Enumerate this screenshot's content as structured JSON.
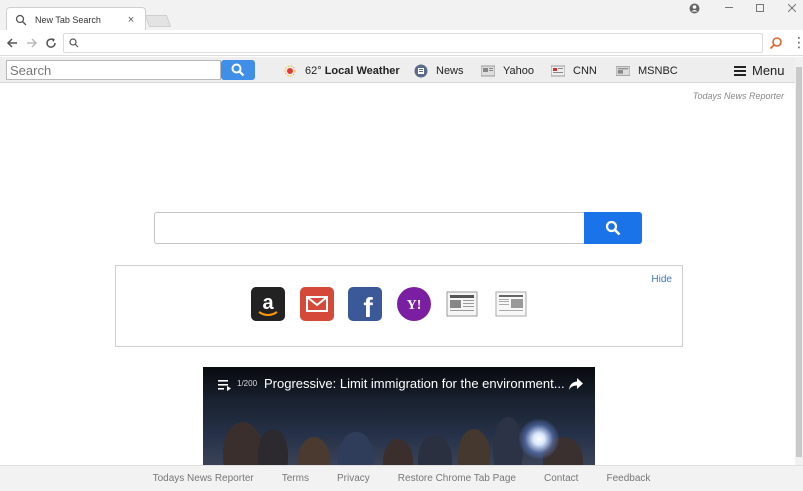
{
  "browser": {
    "tab_title": "New Tab Search",
    "tab_close": "×",
    "omnibox_value": ""
  },
  "extension_bar": {
    "search_placeholder": "Search",
    "weather_temp": "62°",
    "weather_label": "Local Weather",
    "links": [
      "News",
      "Yahoo",
      "CNN",
      "MSNBC"
    ],
    "menu_label": "Menu"
  },
  "page": {
    "brand": "Todays News Reporter",
    "main_search_value": "",
    "shortcuts_hide": "Hide",
    "shortcuts": [
      "amazon-icon",
      "gmail-icon",
      "facebook-icon",
      "yahoo-icon",
      "newspaper-icon",
      "newspaper-icon"
    ]
  },
  "video": {
    "count": "1/200",
    "title": "Progressive: Limit immigration for the environment..."
  },
  "footer": {
    "links": [
      "Todays News Reporter",
      "Terms",
      "Privacy",
      "Restore Chrome Tab Page",
      "Contact",
      "Feedback"
    ]
  },
  "colors": {
    "accent": "#1a73e8",
    "ext_button": "#3f8ee8"
  }
}
